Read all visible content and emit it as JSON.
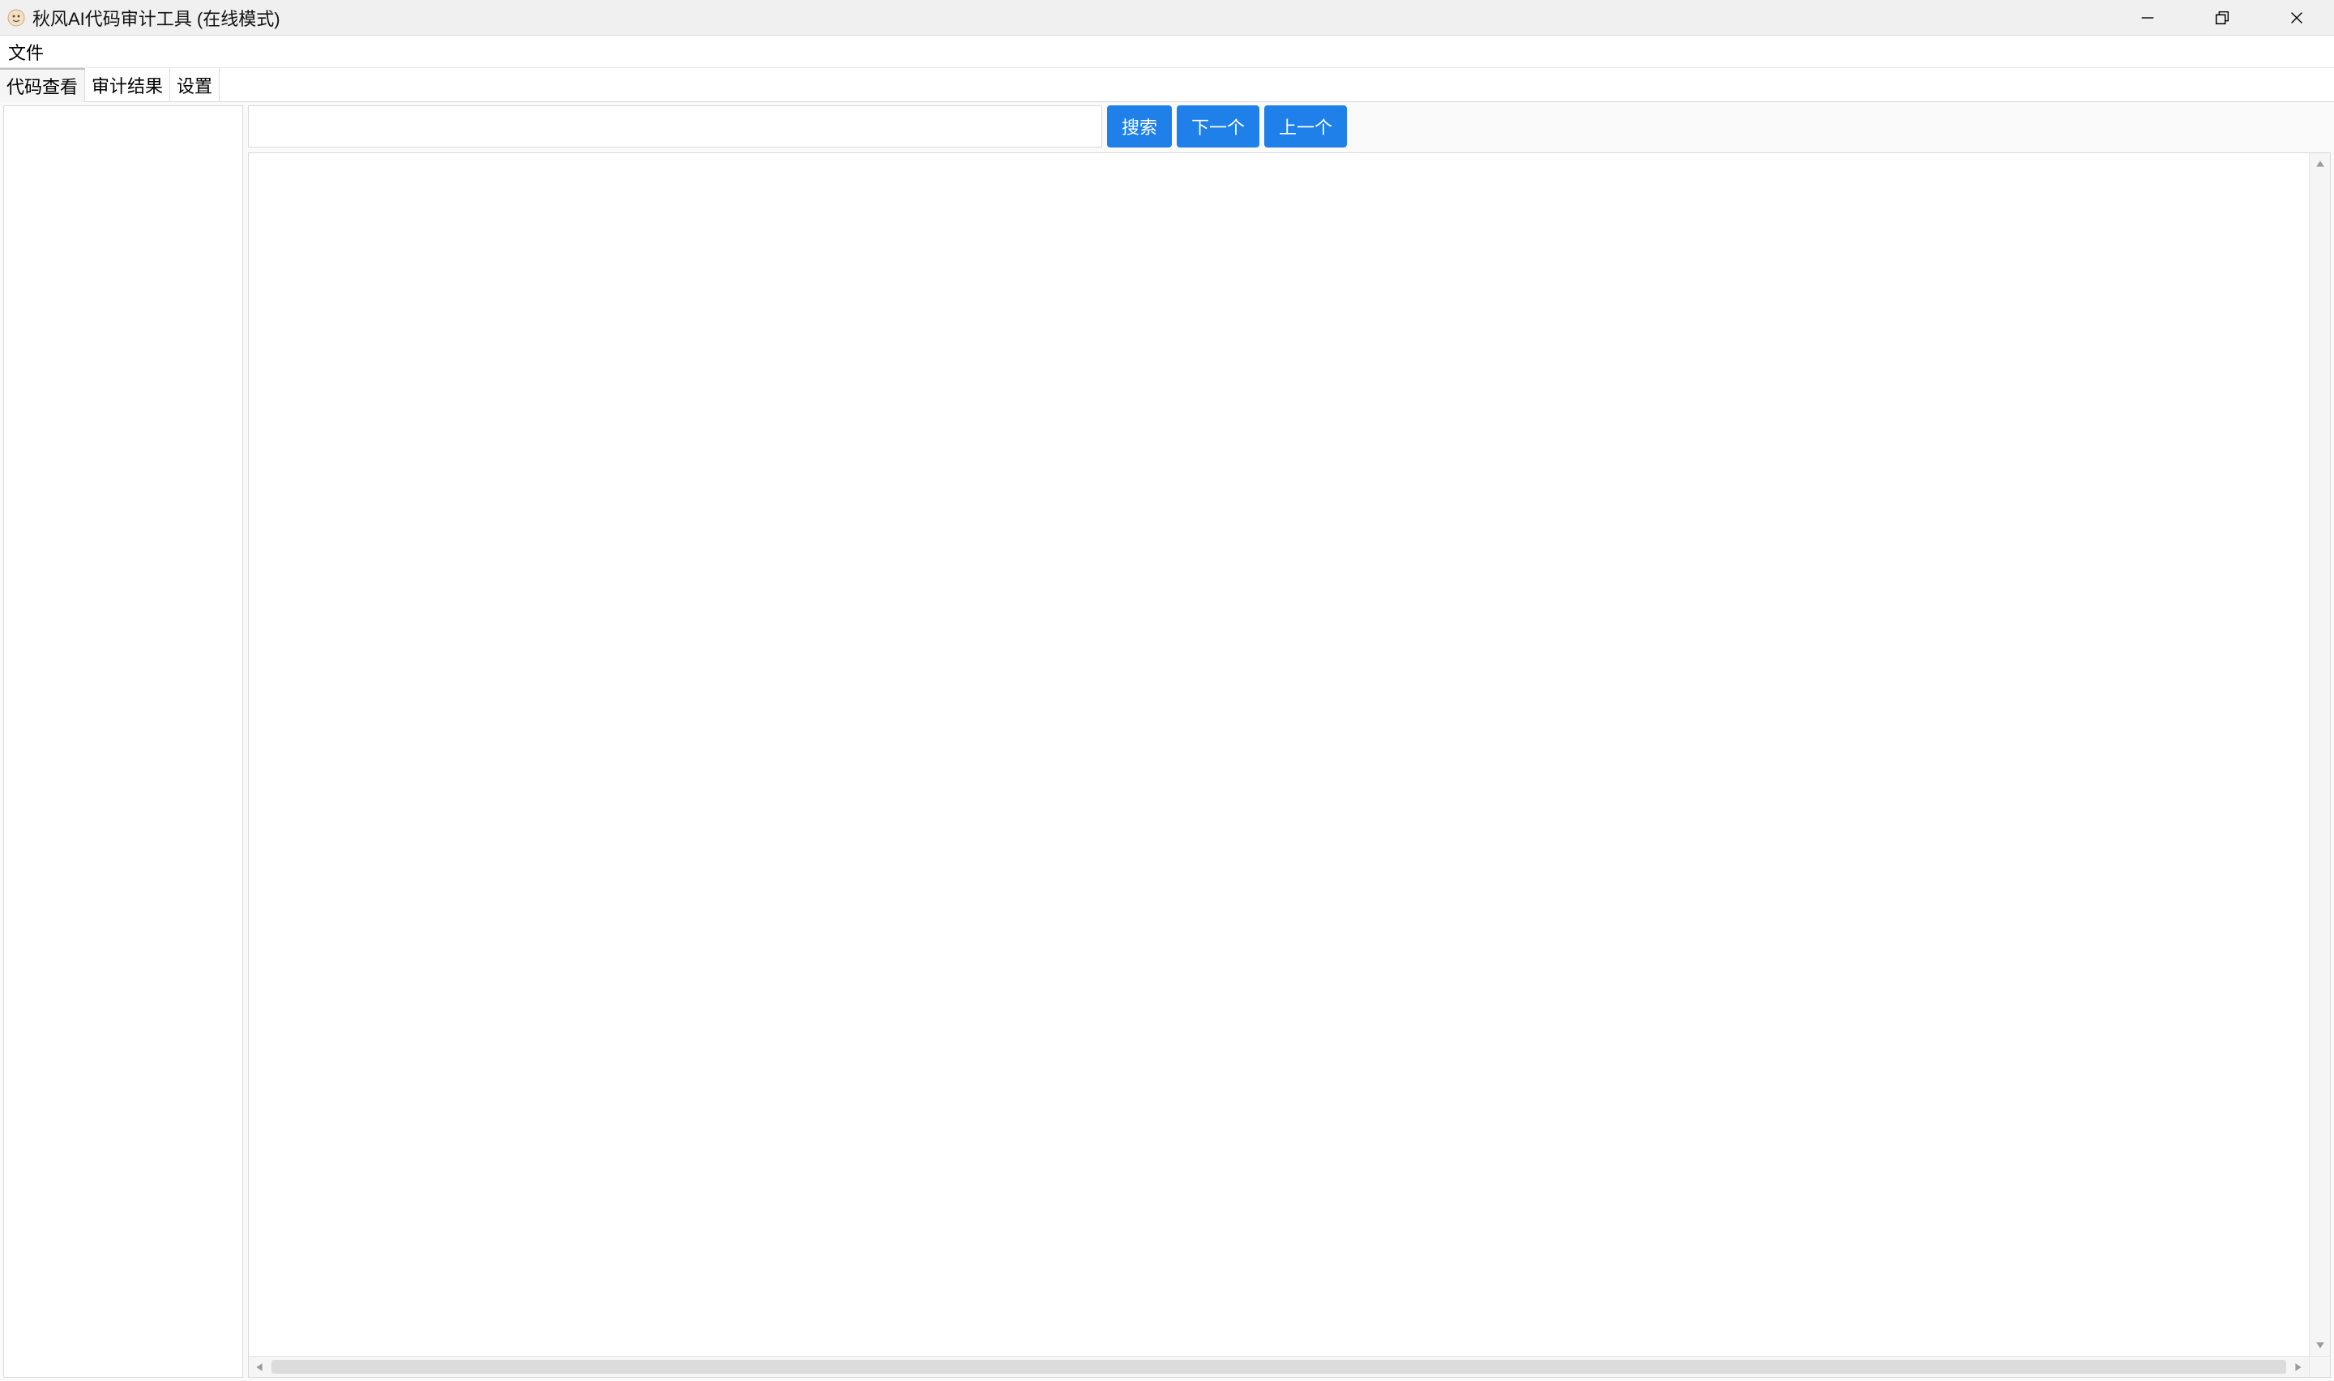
{
  "window": {
    "title": "秋风AI代码审计工具 (在线模式)"
  },
  "menubar": {
    "items": [
      "文件"
    ]
  },
  "tabs": [
    {
      "label": "代码查看",
      "active": true
    },
    {
      "label": "审计结果",
      "active": false
    },
    {
      "label": "设置",
      "active": false
    }
  ],
  "search": {
    "value": "",
    "placeholder": "",
    "buttons": {
      "search": "搜索",
      "next": "下一个",
      "prev": "上一个"
    }
  }
}
